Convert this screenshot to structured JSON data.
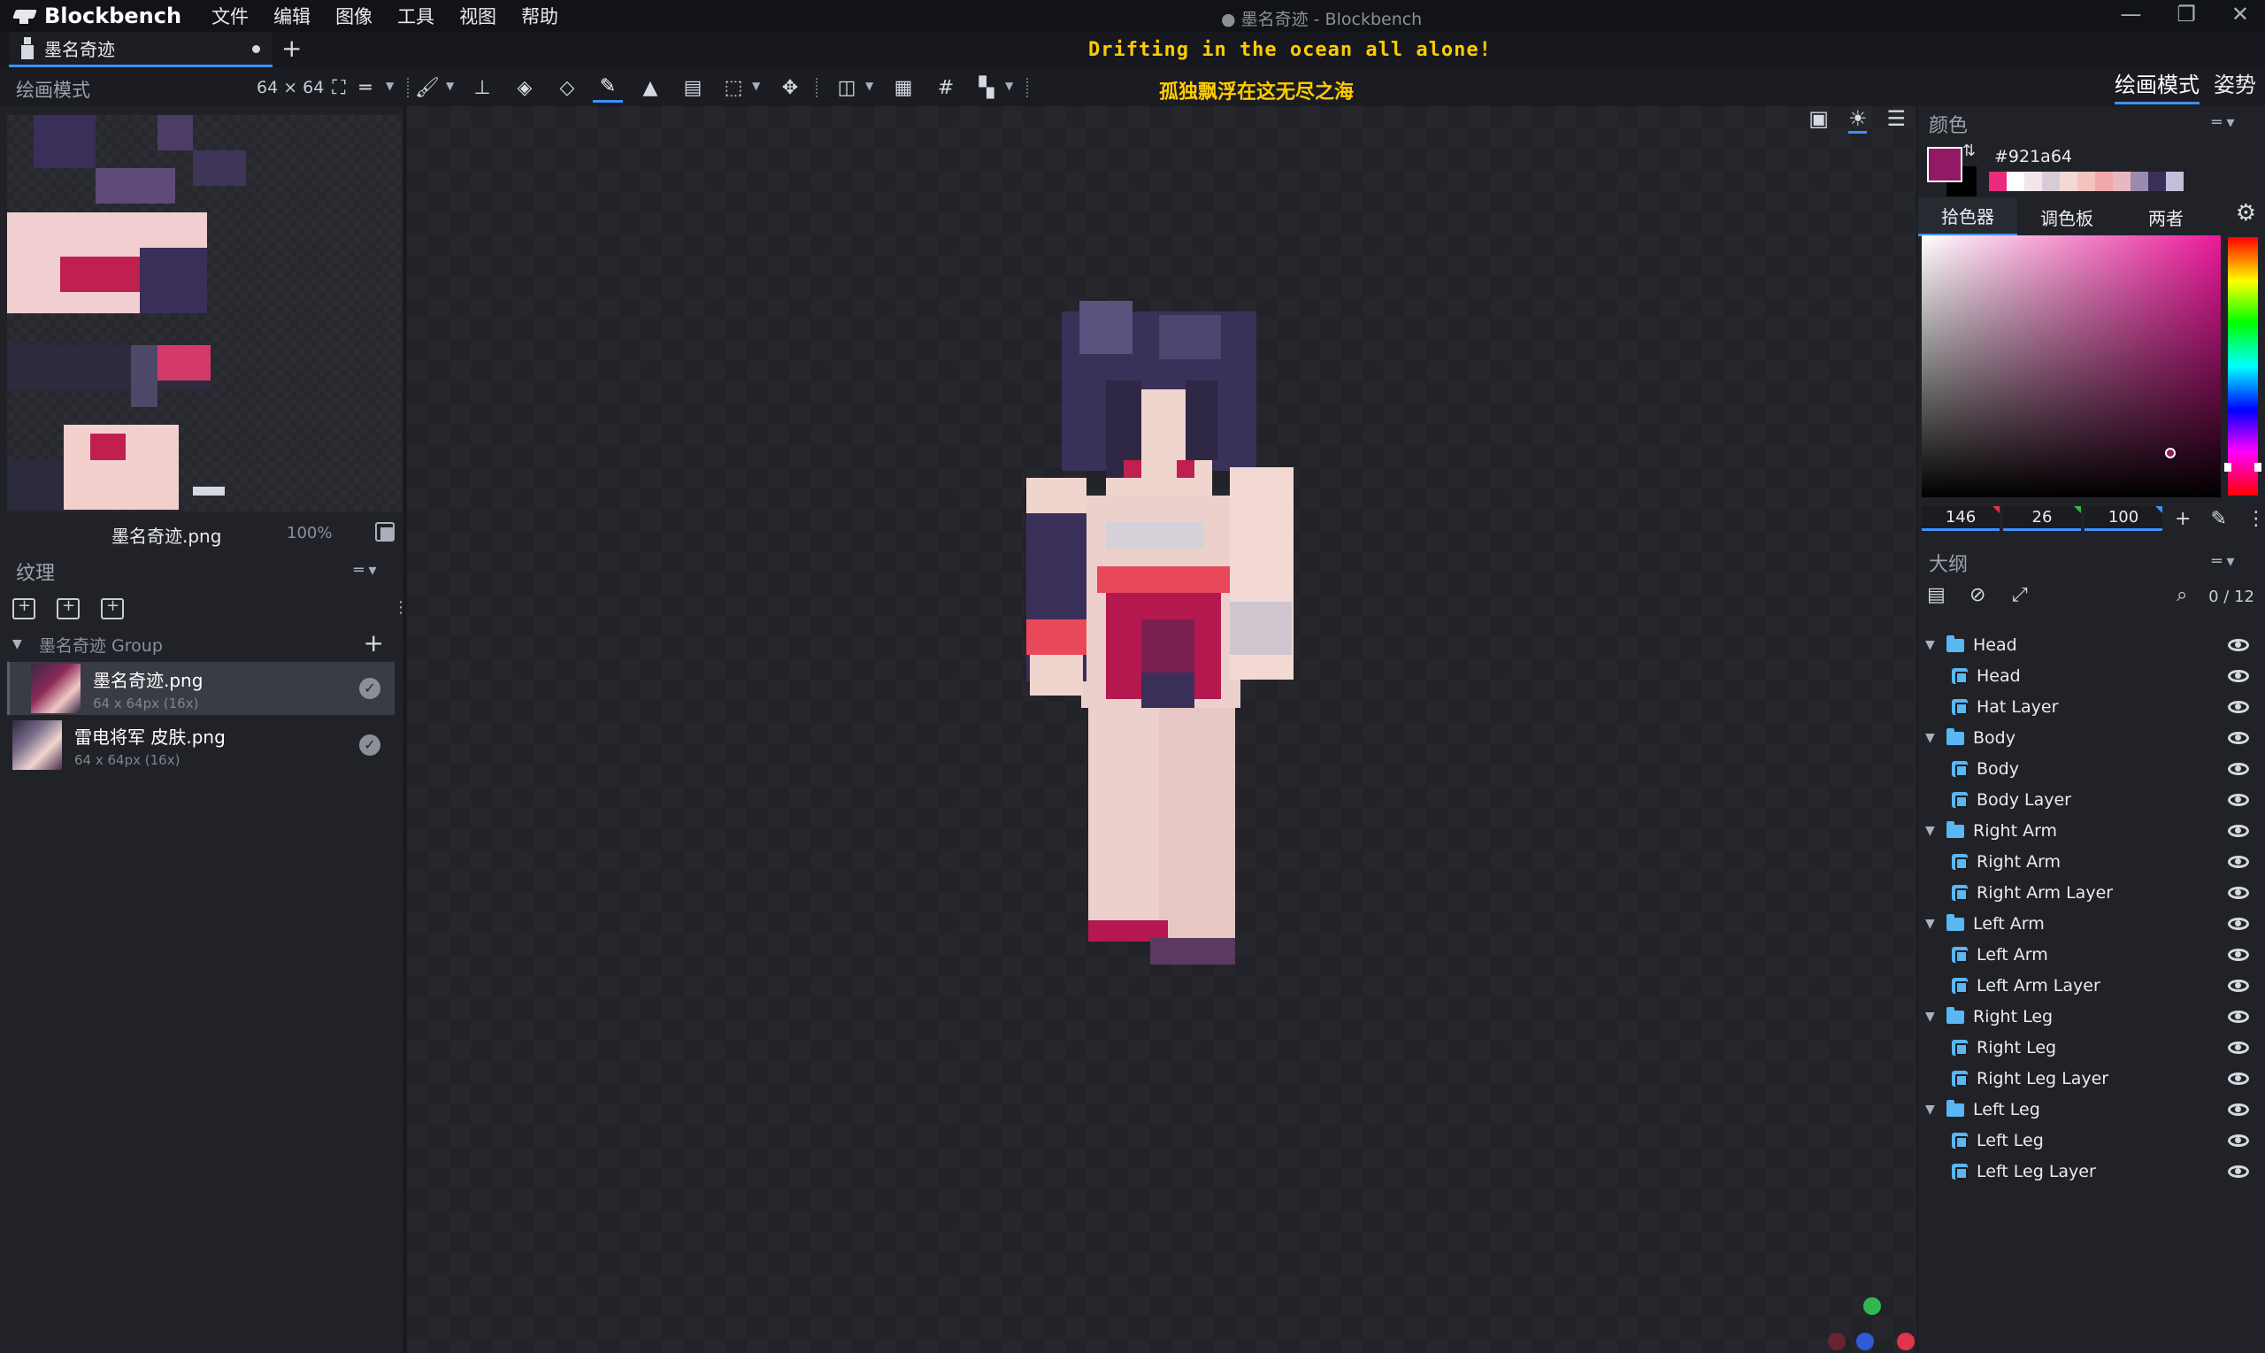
{
  "app": {
    "brand": "Blockbench",
    "window_title": "● 墨名奇迹 - Blockbench",
    "menu": [
      "文件",
      "编辑",
      "图像",
      "工具",
      "视图",
      "帮助"
    ],
    "window_controls": [
      "—",
      "❐",
      "✕"
    ]
  },
  "tab": {
    "label": "墨名奇迹",
    "add": "+"
  },
  "banner": {
    "line1": "Drifting in the ocean all alone!",
    "line2": "孤独飘浮在这无尽之海"
  },
  "toolbar": {
    "mode_label": "绘画模式",
    "texture_size": "64 × 64"
  },
  "mode_buttons": [
    "绘画模式",
    "姿势"
  ],
  "left": {
    "uv_file": "墨名奇迹.png",
    "uv_zoom": "100%",
    "textures_title": "纹理",
    "group_label": "墨名奇迹 Group",
    "textures": [
      {
        "name": "墨名奇迹.png",
        "sub": "64 x 64px (16x)"
      },
      {
        "name": "雷电将军 皮肤.png",
        "sub": "64 x 64px (16x)"
      }
    ]
  },
  "color": {
    "title": "颜色",
    "hex": "#921a64",
    "primary": "#921a64",
    "tabs": [
      "拾色器",
      "调色板",
      "两者"
    ],
    "hsb": [
      "146",
      "26",
      "100"
    ],
    "palette": [
      "#ea2b7c",
      "#ffffff",
      "#f3e5ea",
      "#d7cbd6",
      "#f4d8d8",
      "#f5c3bf",
      "#f0a8a8",
      "#e8b8c0",
      "#9a8ab0",
      "#3a2f58",
      "#c4bfd8"
    ]
  },
  "outline": {
    "title": "大纲",
    "count": "0 / 12",
    "items": [
      {
        "label": "Head",
        "type": "group"
      },
      {
        "label": "Head",
        "type": "cube"
      },
      {
        "label": "Hat Layer",
        "type": "cube"
      },
      {
        "label": "Body",
        "type": "group"
      },
      {
        "label": "Body",
        "type": "cube"
      },
      {
        "label": "Body Layer",
        "type": "cube"
      },
      {
        "label": "Right Arm",
        "type": "group"
      },
      {
        "label": "Right Arm",
        "type": "cube"
      },
      {
        "label": "Right Arm Layer",
        "type": "cube"
      },
      {
        "label": "Left Arm",
        "type": "group"
      },
      {
        "label": "Left Arm",
        "type": "cube"
      },
      {
        "label": "Left Arm Layer",
        "type": "cube"
      },
      {
        "label": "Right Leg",
        "type": "group"
      },
      {
        "label": "Right Leg",
        "type": "cube"
      },
      {
        "label": "Right Leg Layer",
        "type": "cube"
      },
      {
        "label": "Left Leg",
        "type": "group"
      },
      {
        "label": "Left Leg",
        "type": "cube"
      },
      {
        "label": "Left Leg Layer",
        "type": "cube"
      }
    ]
  }
}
